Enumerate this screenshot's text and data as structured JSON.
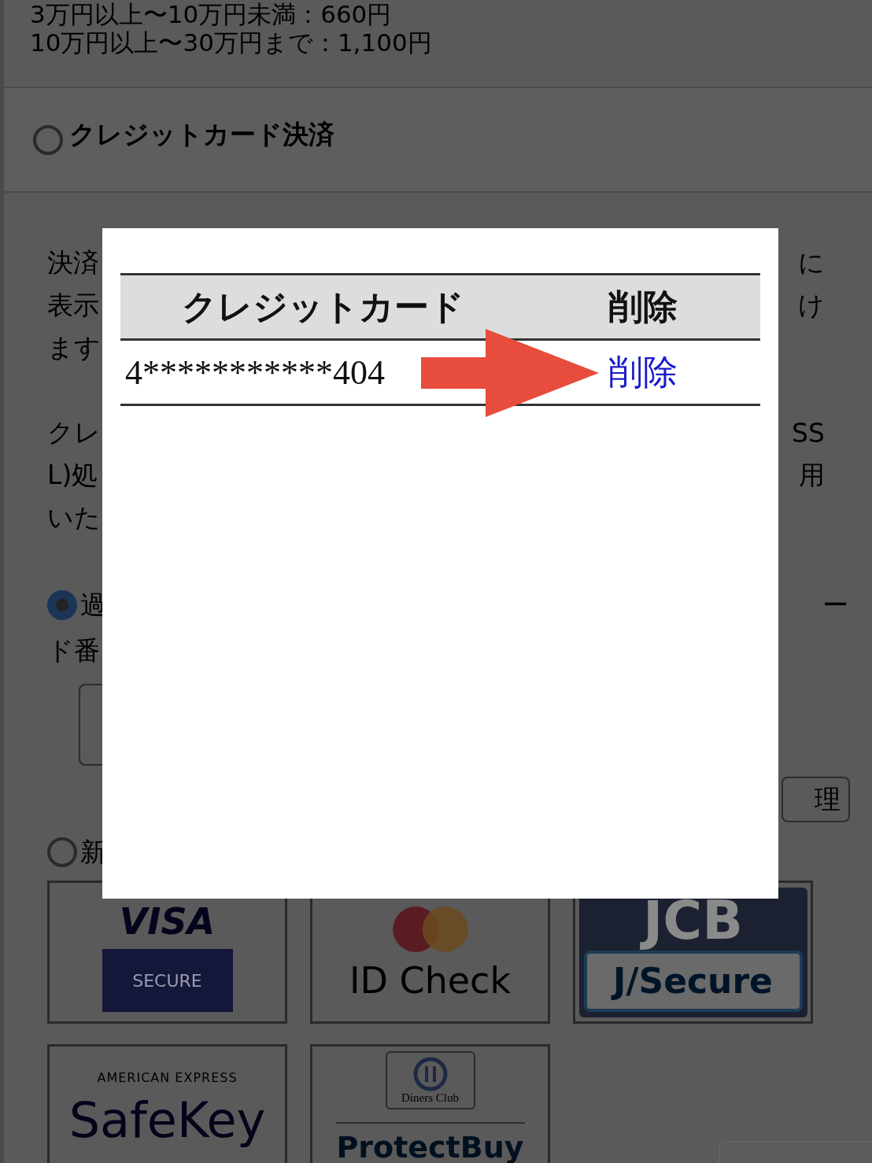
{
  "fee_lines": [
    "3万円以上〜10万円未満：660円",
    "10万円以上〜30万円まで：1,100円"
  ],
  "payment_method": {
    "label": "クレジットカード決済",
    "selected": false
  },
  "notice_fragments": [
    {
      "left": "決済",
      "right": "に"
    },
    {
      "left": "表示",
      "right": "け"
    },
    {
      "left": "ます"
    }
  ],
  "ssl_fragments": [
    {
      "left": "クレ",
      "right": "SS"
    },
    {
      "left": "L)処",
      "right": "用"
    },
    {
      "left": "いた"
    }
  ],
  "card_options": [
    {
      "label": "過",
      "right": "ー",
      "continuation": "ド番",
      "selected": true
    },
    {
      "label": "新",
      "selected": false
    }
  ],
  "update_button": "理",
  "security_logos": [
    {
      "kind": "visa",
      "texts": [
        "VISA",
        "SECURE"
      ]
    },
    {
      "kind": "mastercard",
      "texts": [
        "ID Check"
      ]
    },
    {
      "kind": "jcb",
      "texts": [
        "JCB",
        "J/Secure"
      ]
    },
    {
      "kind": "amex",
      "texts": [
        "AMERICAN EXPRESS",
        "SafeKey"
      ]
    },
    {
      "kind": "diners",
      "texts": [
        "Diners Club",
        "ProtectBuy"
      ]
    }
  ],
  "dialog": {
    "table": {
      "columns": [
        "クレジットカード",
        "削除"
      ],
      "rows": [
        {
          "card": "4***********404",
          "action": "削除"
        }
      ]
    }
  }
}
